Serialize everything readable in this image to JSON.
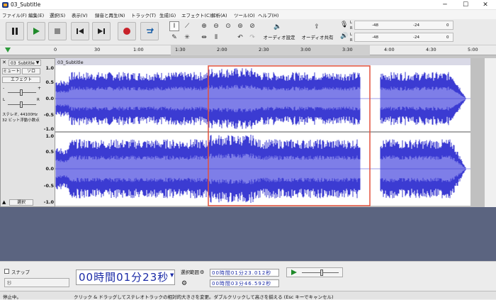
{
  "window": {
    "title": "03_Subtitle",
    "minimize": "─",
    "maximize": "☐",
    "close": "✕"
  },
  "menu": [
    {
      "label": "ファイル(F)"
    },
    {
      "label": "編集(E)"
    },
    {
      "label": "選択(S)"
    },
    {
      "label": "表示(V)"
    },
    {
      "label": "録音と再生(N)"
    },
    {
      "label": "トラック(T)"
    },
    {
      "label": "生成(G)"
    },
    {
      "label": "エフェクト(C)"
    },
    {
      "label": "解析(A)"
    },
    {
      "label": "ツール(O)"
    },
    {
      "label": "ヘルプ(H)"
    }
  ],
  "toolbar": {
    "audio_setup": "オーディオ設定",
    "share_audio": "オーディオ共有",
    "meter_ticks": [
      "-48",
      "-24",
      "0"
    ],
    "meter_rec_l": "L",
    "meter_rec_r": "R",
    "meter_play_l": "L",
    "meter_play_r": "R"
  },
  "ruler": {
    "ticks": [
      "0",
      "30",
      "1:00",
      "1:30",
      "2:00",
      "2:30",
      "3:00",
      "3:30",
      "4:00",
      "4:30",
      "5:00"
    ]
  },
  "track": {
    "name": "03_Subtitle",
    "mute": "ミュート",
    "solo": "ソロ",
    "effects": "エフェクト",
    "gain_minus": "-",
    "gain_plus": "+",
    "pan_l": "L",
    "pan_r": "R",
    "info_line1": "ステレオ, 44100Hz",
    "info_line2": "32 ビット浮動小数点",
    "select": "選択",
    "scale": [
      "1.0",
      "0.5",
      "0.0",
      "-0.5",
      "-1.0",
      "1.0",
      "0.5",
      "0.0",
      "-0.5",
      "-1.0"
    ]
  },
  "bottom": {
    "snap_label": "スナップ",
    "snap_unit": "秒",
    "time_display": "00時間01分23秒",
    "selection_label": "選択範囲",
    "sel_start": "00時間01分23.012秒",
    "sel_end": "00時間03分46.592秒"
  },
  "status": {
    "left": "停止中。",
    "hint": "クリック & ドラッグしてステレオトラックの相対的大きさを変更。ダブルクリックして高さを揃える (Esc キーでキャンセル)"
  },
  "colors": {
    "wave": "#3b3bd2",
    "wave_light": "#7e7ee8",
    "selection_outline": "#e4503a",
    "track_bg": "#c0c0c0"
  }
}
